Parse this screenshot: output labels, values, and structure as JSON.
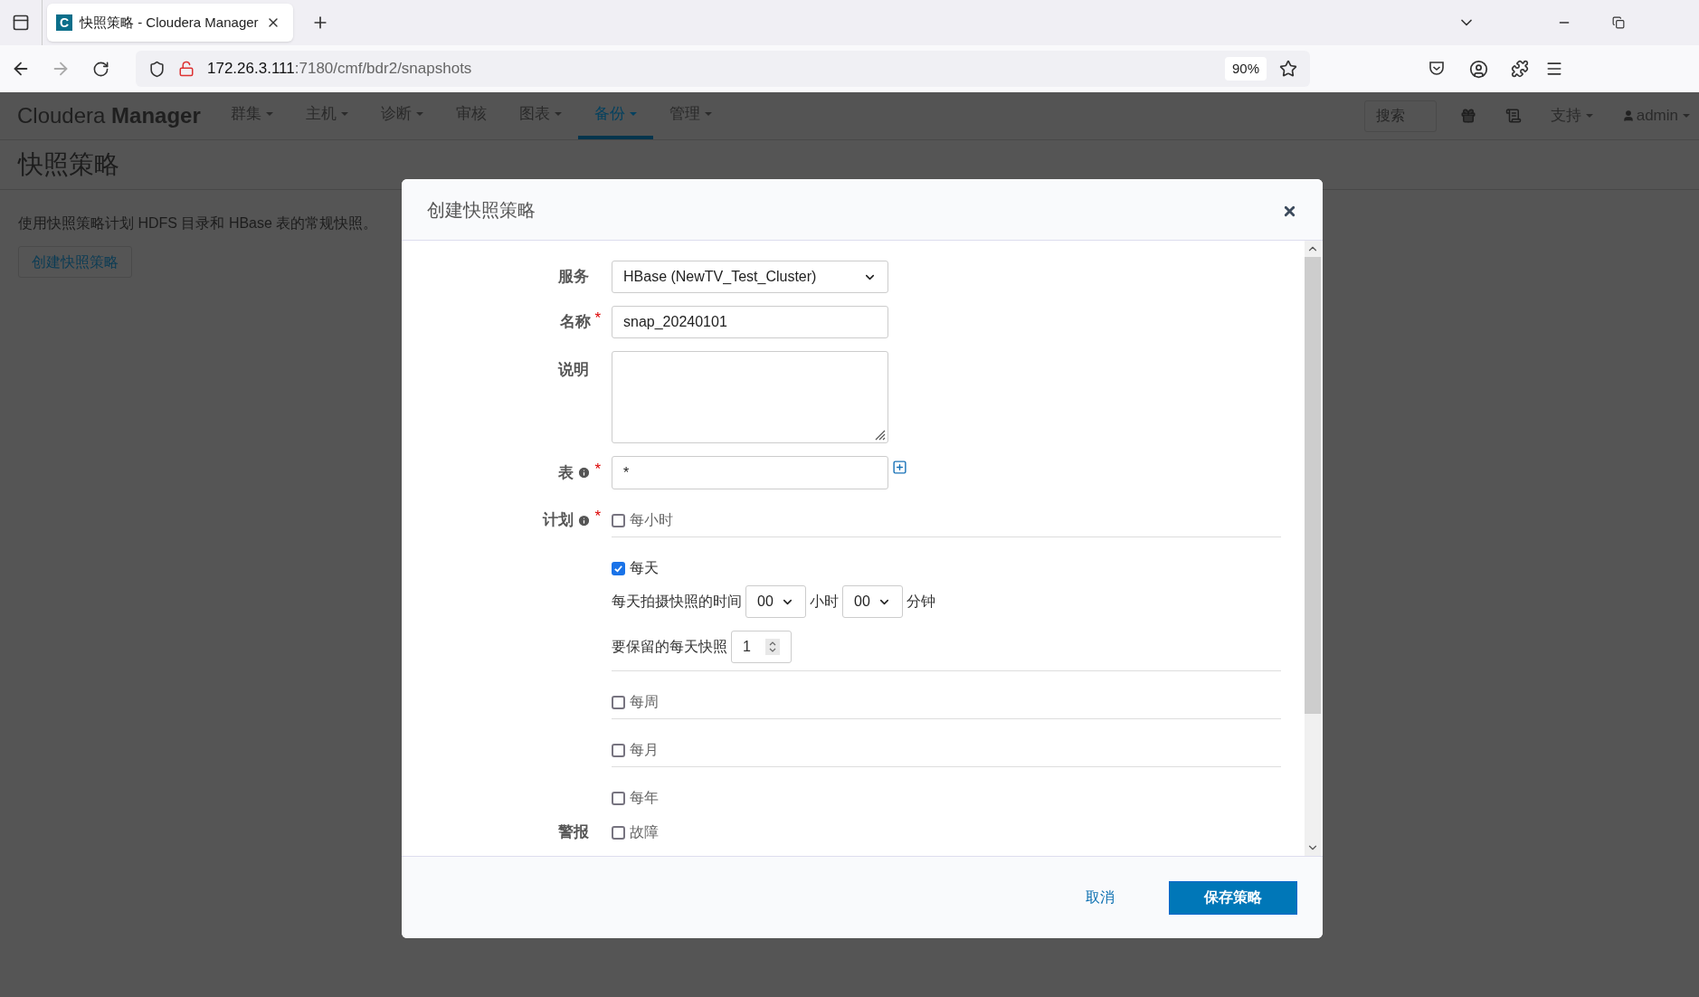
{
  "browser": {
    "tab_title": "快照策略 - Cloudera Manager",
    "tab_icon_letter": "C",
    "address_host": "172.26.3.111",
    "address_path": ":7180/cmf/bdr2/snapshots",
    "zoom": "90%"
  },
  "nav": {
    "brand_light": "Cloudera",
    "brand_bold": "Manager",
    "items": [
      {
        "label": "群集",
        "dropdown": true,
        "selected": false
      },
      {
        "label": "主机",
        "dropdown": true,
        "selected": false
      },
      {
        "label": "诊断",
        "dropdown": true,
        "selected": false
      },
      {
        "label": "审核",
        "dropdown": false,
        "selected": false
      },
      {
        "label": "图表",
        "dropdown": true,
        "selected": false
      },
      {
        "label": "备份",
        "dropdown": true,
        "selected": true
      },
      {
        "label": "管理",
        "dropdown": true,
        "selected": false
      }
    ],
    "search_placeholder": "搜索",
    "support": "支持",
    "user": "admin"
  },
  "page": {
    "title": "快照策略",
    "description": "使用快照策略计划 HDFS 目录和 HBase 表的常规快照。",
    "create_button": "创建快照策略"
  },
  "dialog": {
    "title": "创建快照策略",
    "service": {
      "label": "服务",
      "value": "HBase (NewTV_Test_Cluster)"
    },
    "name": {
      "label": "名称",
      "required": true,
      "value": "snap_20240101"
    },
    "description": {
      "label": "说明"
    },
    "table": {
      "label": "表",
      "required": true,
      "value": "*"
    },
    "schedule": {
      "label": "计划",
      "required": true,
      "options": [
        {
          "label": "每小时",
          "checked": false
        },
        {
          "label": "每天",
          "checked": true,
          "detail": {
            "time_label": "每天拍摄快照的时间",
            "hour": "00",
            "hour_unit": "小时",
            "minute": "00",
            "minute_unit": "分钟",
            "keep_label": "要保留的每天快照",
            "keep": "1"
          }
        },
        {
          "label": "每周",
          "checked": false
        },
        {
          "label": "每月",
          "checked": false
        },
        {
          "label": "每年",
          "checked": false
        }
      ]
    },
    "alerts": {
      "label": "警报",
      "options": [
        {
          "label": "故障",
          "checked": false
        }
      ]
    },
    "cancel": "取消",
    "save": "保存策略"
  }
}
